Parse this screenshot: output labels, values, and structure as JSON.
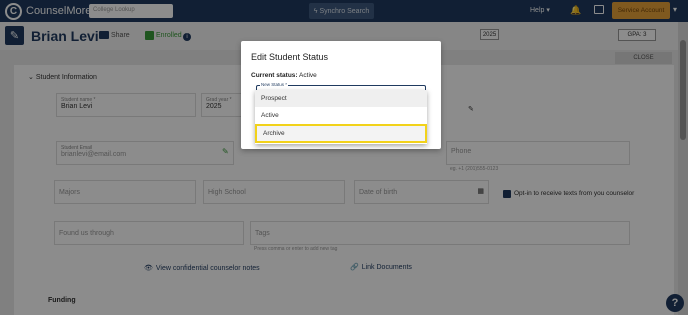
{
  "app": {
    "name": "CounselMore",
    "logo_letter": "C"
  },
  "topbar": {
    "college_lookup_placeholder": "College Lookup",
    "synchro_search": "Synchro Search",
    "help": "Help",
    "service_account": "Service Account"
  },
  "student": {
    "name": "Brian Levi",
    "share": "Share",
    "enrolled": "Enrolled",
    "grad_year": "2025",
    "gpa": "GPA: 3",
    "close": "CLOSE"
  },
  "form": {
    "section_title": "Student Information",
    "student_name_label": "Student name *",
    "student_name_value": "Brian Levi",
    "grad_year_label": "Grad year *",
    "grad_year_value": "2025",
    "email_label": "Student Email",
    "email_value": "brianlevi@email.com",
    "phone_label": "Phone",
    "phone_hint": "eg. +1 (201)555-0123",
    "majors_placeholder": "Majors",
    "high_school_placeholder": "High School",
    "dob_placeholder": "Date of birth",
    "opt_in": "Opt-in to receive texts from you counselor",
    "found_us_placeholder": "Found us through",
    "tags_placeholder": "Tags",
    "tags_hint": "Press comma or enter to add new tag",
    "view_notes": "View confidential counselor notes",
    "link_documents": "Link Documents",
    "next_section": "Funding"
  },
  "modal": {
    "title": "Edit Student Status",
    "current_label": "Current status:",
    "current_value": "Active",
    "select_label": "New Status *",
    "options": [
      "Prospect",
      "Active",
      "Archive"
    ],
    "highlighted_option": "Archive"
  }
}
